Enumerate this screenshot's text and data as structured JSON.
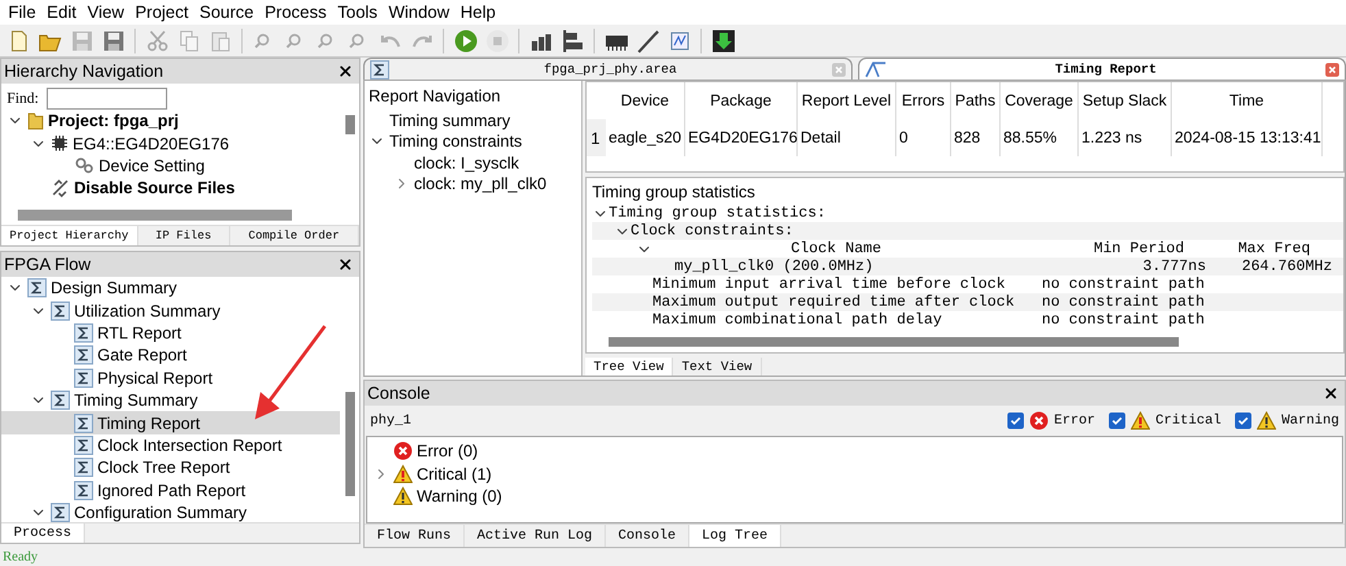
{
  "menu": [
    "File",
    "Edit",
    "View",
    "Project",
    "Source",
    "Process",
    "Tools",
    "Window",
    "Help"
  ],
  "toolbar": [
    {
      "kind": "new",
      "disabled": false
    },
    {
      "kind": "open",
      "disabled": false
    },
    {
      "kind": "save",
      "disabled": true
    },
    {
      "kind": "save",
      "disabled": false
    },
    {
      "kind": "sep"
    },
    {
      "kind": "cut",
      "disabled": true
    },
    {
      "kind": "copy",
      "disabled": true
    },
    {
      "kind": "paste",
      "disabled": true
    },
    {
      "kind": "sep"
    },
    {
      "kind": "find",
      "disabled": true
    },
    {
      "kind": "find",
      "disabled": true
    },
    {
      "kind": "find",
      "disabled": true
    },
    {
      "kind": "find",
      "disabled": true
    },
    {
      "kind": "undo",
      "disabled": true
    },
    {
      "kind": "redo",
      "disabled": true
    },
    {
      "kind": "sep"
    },
    {
      "kind": "run",
      "disabled": false
    },
    {
      "kind": "stop",
      "disabled": true
    },
    {
      "kind": "sep"
    },
    {
      "kind": "bars",
      "disabled": false
    },
    {
      "kind": "hbars",
      "disabled": false
    },
    {
      "kind": "sep"
    },
    {
      "kind": "chip",
      "disabled": false
    },
    {
      "kind": "probe",
      "disabled": false
    },
    {
      "kind": "wave",
      "disabled": false
    },
    {
      "kind": "sep"
    },
    {
      "kind": "download",
      "disabled": false
    }
  ],
  "hierarchy": {
    "title": "Hierarchy Navigation",
    "find_label": "Find:",
    "tree": [
      {
        "label": "Project: fpga_prj",
        "kind": "folder",
        "bold": true,
        "expanded": true,
        "children": [
          {
            "label": "EG4::EG4D20EG176",
            "kind": "chip",
            "bold": false,
            "expanded": true,
            "children": [
              {
                "label": "Device Setting",
                "kind": "gear",
                "bold": false
              }
            ]
          },
          {
            "label": "Disable Source Files",
            "kind": "disable",
            "bold": true
          }
        ]
      }
    ],
    "tabs": [
      {
        "label": "Project Hierarchy",
        "selected": true
      },
      {
        "label": "IP Files",
        "selected": false
      },
      {
        "label": "Compile Order",
        "selected": false
      }
    ]
  },
  "flow": {
    "title": "FPGA Flow",
    "tree": [
      {
        "label": "Design Summary",
        "selected": false,
        "expanded": true,
        "children": [
          {
            "label": "Utilization Summary",
            "selected": false,
            "expanded": true,
            "children": [
              {
                "label": "RTL Report",
                "selected": false
              },
              {
                "label": "Gate Report",
                "selected": false
              },
              {
                "label": "Physical Report",
                "selected": false
              }
            ]
          },
          {
            "label": "Timing Summary",
            "selected": false,
            "expanded": true,
            "children": [
              {
                "label": "Timing Report",
                "selected": true
              },
              {
                "label": "Clock Intersection Report",
                "selected": false
              },
              {
                "label": "Clock Tree Report",
                "selected": false
              },
              {
                "label": "Ignored Path Report",
                "selected": false
              }
            ]
          },
          {
            "label": "Configuration Summary",
            "selected": false,
            "expanded": true
          }
        ]
      }
    ],
    "tabs": [
      {
        "label": "Process",
        "selected": true
      }
    ]
  },
  "editor_tabs": [
    {
      "label": "fpga_prj_phy.area",
      "selected": false
    },
    {
      "label": "Timing Report",
      "selected": true
    }
  ],
  "report_nav": {
    "title": "Report Navigation",
    "tree": [
      {
        "label": "Timing summary"
      },
      {
        "label": "Timing constraints",
        "expanded": true,
        "children": [
          {
            "label": "clock: I_sysclk"
          },
          {
            "label": "clock: my_pll_clk0",
            "expanded": false
          }
        ]
      }
    ]
  },
  "summary_table": {
    "columns": [
      "Device",
      "Package",
      "Report Level",
      "Errors",
      "Paths",
      "Coverage",
      "Setup Slack",
      "Time"
    ],
    "rows": [
      {
        "index": "1",
        "cells": [
          "eagle_s20",
          "EG4D20EG176",
          "Detail",
          "0",
          "828",
          "88.55%",
          "1.223 ns",
          "2024-08-15 13:13:41"
        ]
      }
    ]
  },
  "timing_group": {
    "title": "Timing group statistics",
    "tree": [
      {
        "kind": "group",
        "cells": [
          "Timing group statistics:"
        ],
        "expanded": true,
        "children": [
          {
            "kind": "group",
            "cells": [
              "Clock constraints:"
            ],
            "expanded": true,
            "children": [
              {
                "kind": "header",
                "cells": [
                  "Clock Name",
                  "Min Period",
                  "Max Freq"
                ],
                "expanded": true,
                "children": [
                  {
                    "kind": "data",
                    "cells": [
                      "my_pll_clk0 (200.0MHz)",
                      "3.777ns",
                      "264.760MHz"
                    ]
                  }
                ]
              },
              {
                "kind": "item",
                "cells": [
                  "Minimum input arrival time before clock",
                  "no constraint path"
                ]
              },
              {
                "kind": "item",
                "cells": [
                  "Maximum output required time after clock",
                  "no constraint path"
                ]
              },
              {
                "kind": "item",
                "cells": [
                  "Maximum combinational path delay",
                  "no constraint path"
                ]
              }
            ]
          }
        ]
      }
    ],
    "view_tabs": [
      {
        "label": "Tree View",
        "selected": true
      },
      {
        "label": "Text View",
        "selected": false
      }
    ]
  },
  "console": {
    "title": "Console",
    "run": "phy_1",
    "filters": [
      {
        "label": "Error",
        "kind": "error",
        "checked": true
      },
      {
        "label": "Critical",
        "kind": "critical",
        "checked": true
      },
      {
        "label": "Warning",
        "kind": "warning",
        "checked": true
      }
    ],
    "messages": [
      {
        "kind": "error",
        "text": "Error (0)"
      },
      {
        "kind": "critical",
        "text": "Critical (1)",
        "expanded": false
      },
      {
        "kind": "warning",
        "text": "Warning (0)"
      }
    ],
    "tabs": [
      {
        "label": "Flow Runs",
        "selected": false
      },
      {
        "label": "Active Run Log",
        "selected": false
      },
      {
        "label": "Console",
        "selected": false
      },
      {
        "label": "Log Tree",
        "selected": true
      }
    ]
  },
  "status": "Ready"
}
